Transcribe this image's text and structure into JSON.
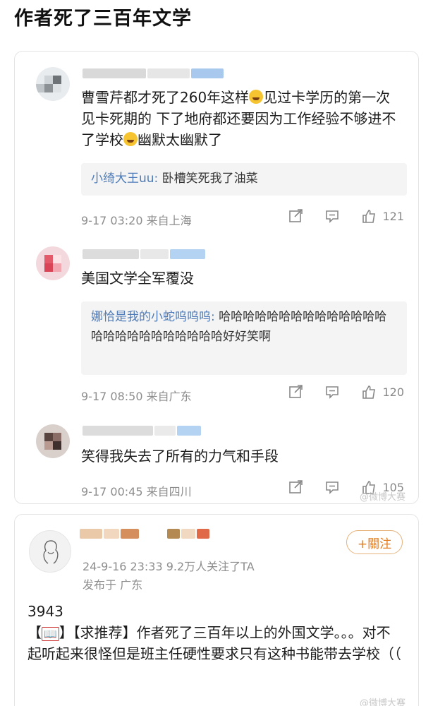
{
  "page_title": "作者死了三百年文学",
  "comments": [
    {
      "text_parts": [
        "曹雪芹都才死了260年这样",
        "见过卡学历的第一次见卡死期的 下了地府都还要因为工作经验不够进不了学校",
        "幽默太幽默了"
      ],
      "reply_name": "小绮大王uu:",
      "reply_text": " 卧槽笑死我了油菜",
      "meta": "9-17 03:20  来自上海",
      "likes": "121"
    },
    {
      "text": "美国文学全军覆没",
      "reply_name": "娜恰是我的小蛇呜呜呜:",
      "reply_text": " 哈哈哈哈哈哈哈哈哈哈哈哈哈哈哈哈哈哈哈哈哈哈哈哈哈好好笑啊",
      "meta": "9-17 08:50  来自广东",
      "likes": "120"
    },
    {
      "text": "笑得我失去了所有的力气和手段",
      "meta": "9-17 00:45  来自四川",
      "likes": "105"
    }
  ],
  "watermark_top": "@微博大赛",
  "post": {
    "follow_label": "+關注",
    "date_line": "24-9-16 23:33  9.2万人关注了TA",
    "location_line": "发布于 广东",
    "number": "3943",
    "book_icon_label": "📖",
    "text": "【求推荐】作者死了三百年以上的外国文学。。。对不起听起来很怪但是班主任硬性要求只有这种书能带去学校（（",
    "watermark": "@微博大赛"
  },
  "colors": {
    "accent": "#e07b20",
    "link": "#4f7cb8",
    "meta": "#8d8d8d"
  }
}
